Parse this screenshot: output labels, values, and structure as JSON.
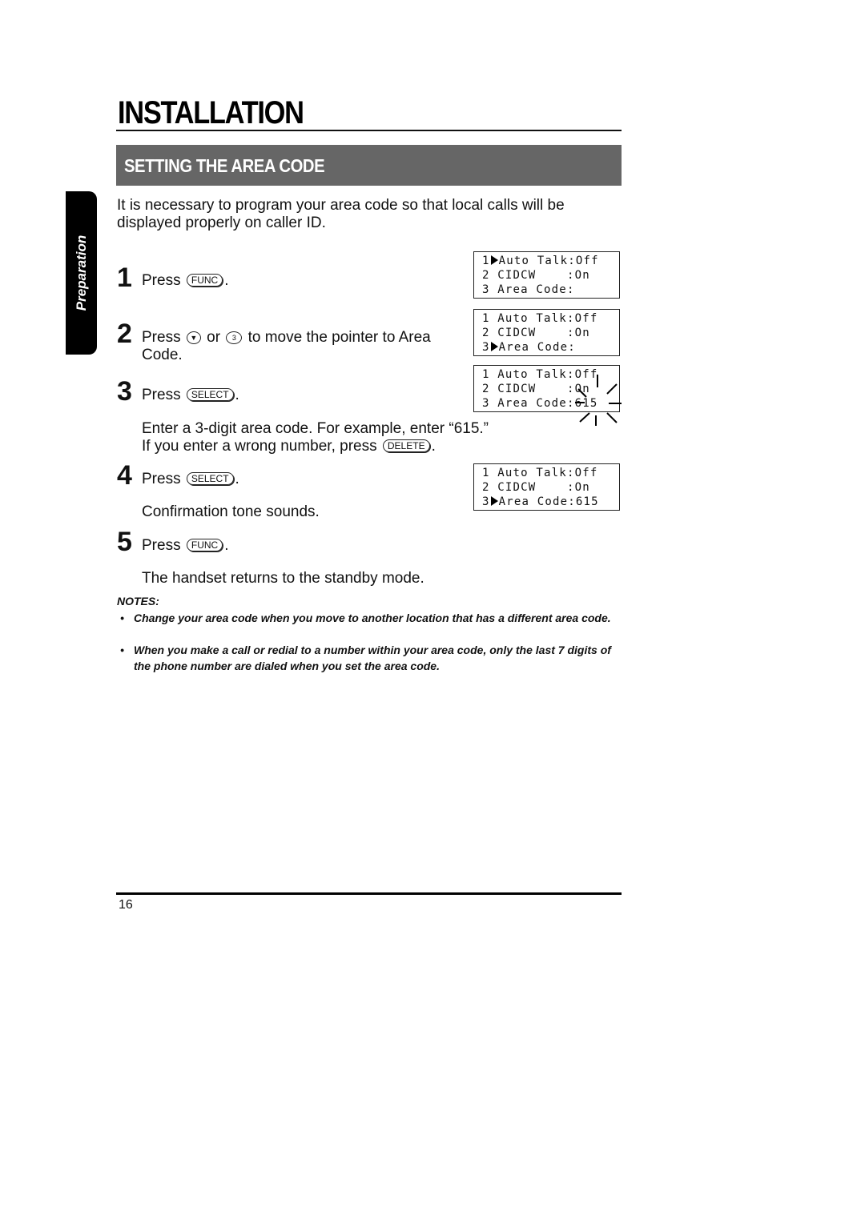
{
  "header": {
    "title": "INSTALLATION",
    "section_title": "SETTING THE AREA CODE",
    "side_tab": "Preparation"
  },
  "intro": "It is necessary to program your area code so that local calls will be displayed properly on caller ID.",
  "steps": [
    {
      "number": "1",
      "text_before": "Press",
      "key": "FUNC",
      "text_after": "."
    },
    {
      "number": "2",
      "text_before": "Press",
      "key_icon": "down-arrow",
      "or": "or",
      "key2": "3",
      "text_after": "to move the pointer to Area",
      "text_line2": "Code."
    },
    {
      "number": "3",
      "text_before": "Press",
      "key": "SELECT",
      "text_after": ".",
      "detail_line1": "Enter a 3-digit area code.  For example, enter “615.”",
      "detail_line2": "If you enter a wrong number, press",
      "detail_key": "DELETE",
      "detail_after": "."
    },
    {
      "number": "4",
      "text_before": "Press",
      "key": "SELECT",
      "text_after": ".",
      "detail": "Confirmation tone sounds."
    },
    {
      "number": "5",
      "text_before": "Press",
      "key": "FUNC",
      "text_after": ".",
      "detail": "The handset returns to the standby mode."
    }
  ],
  "displays": [
    {
      "lines": [
        {
          "num": "1",
          "ptr": true,
          "text": "Auto Talk:Off"
        },
        {
          "num": "2",
          "ptr": false,
          "text": "CIDCW    :On"
        },
        {
          "num": "3",
          "ptr": false,
          "text": "Area Code:"
        }
      ]
    },
    {
      "lines": [
        {
          "num": "1",
          "ptr": false,
          "text": "Auto Talk:Off"
        },
        {
          "num": "2",
          "ptr": false,
          "text": "CIDCW    :On"
        },
        {
          "num": "3",
          "ptr": true,
          "text": "Area Code:"
        }
      ]
    },
    {
      "lines": [
        {
          "num": "1",
          "ptr": false,
          "text": "Auto Talk:Off"
        },
        {
          "num": "2",
          "ptr": false,
          "text": "CIDCW    :On"
        },
        {
          "num": "3",
          "ptr": false,
          "text": "Area Code:615"
        }
      ],
      "flashing": true
    },
    {
      "lines": [
        {
          "num": "1",
          "ptr": false,
          "text": "Auto Talk:Off"
        },
        {
          "num": "2",
          "ptr": false,
          "text": "CIDCW    :On"
        },
        {
          "num": "3",
          "ptr": true,
          "text": "Area Code:615"
        }
      ]
    }
  ],
  "notes": {
    "heading": "NOTES:",
    "items": [
      "Change your area code when you move to another location that has a different area code.",
      "When you make a call or redial to a number within your area code, only the last 7 digits of the phone number are dialed when you set the area code."
    ],
    "bullet": "•"
  },
  "footer": {
    "page_number": "16"
  }
}
